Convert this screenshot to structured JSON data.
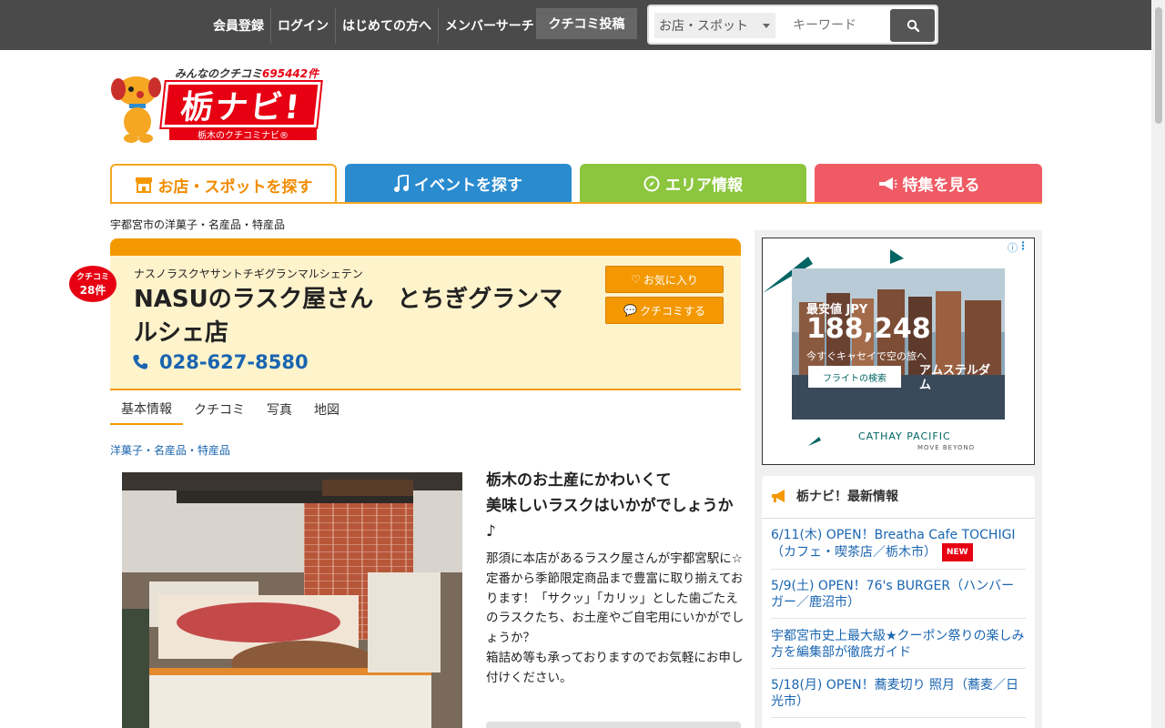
{
  "topnav": {
    "items": [
      "会員登録",
      "ログイン",
      "はじめての方へ",
      "メンバーサーチ"
    ],
    "review_post": "クチコミ投稿",
    "search_select": "お店・スポット",
    "search_placeholder": "キーワード"
  },
  "logo": {
    "count_prefix": "みんなのクチコミ",
    "count": "695442件",
    "title": "栃ナビ!",
    "subtitle": "栃木のクチコミナビ®"
  },
  "tabs": [
    {
      "label": "お店・スポットを探す",
      "icon": "shop-icon",
      "color": "#f39800"
    },
    {
      "label": "イベントを探す",
      "icon": "music-note-icon",
      "color": "#2b8bcf"
    },
    {
      "label": "エリア情報",
      "icon": "compass-icon",
      "color": "#8cc63f"
    },
    {
      "label": "特集を見る",
      "icon": "megaphone-icon",
      "color": "#ef5a64"
    }
  ],
  "breadcrumb": "宇都宮市の洋菓子・名産品・特産品",
  "shop": {
    "badge_top": "クチコミ",
    "badge_count": "28件",
    "kana": "ナスノラスクヤサントチギグランマルシェテン",
    "name": "NASUのラスク屋さん　とちぎグランマルシェ店",
    "phone": "028-627-8580",
    "fav_label": "お気に入り",
    "review_label": "クチコミする"
  },
  "subtabs": [
    "基本情報",
    "クチコミ",
    "写真",
    "地図"
  ],
  "category": "洋菓子・名産品・特産品",
  "description": {
    "title_line1": "栃木のお土産にかわいくて",
    "title_line2": "美味しいラスクはいかがでしょうか♪",
    "body_line1": "那須に本店があるラスク屋さんが宇都宮駅に☆",
    "body_line2": "定番から季節限定商品まで豊富に取り揃えております！「サクッ」「カリッ」とした歯ごたえのラスクたち、お土産やご自宅用にいかがでしょうか？",
    "body_line3": "箱詰め等も承っておりますのでお気軽にお申し付けください。"
  },
  "ad": {
    "label": "最安値 JPY",
    "price": "188,248",
    "tagline": "今すぐキャセイで空の旅へ",
    "button": "フライトの検索",
    "destination": "アムステルダム",
    "brand": "CATHAY PACIFIC",
    "brand_sub": "MOVE BEYOND"
  },
  "news": {
    "heading": "栃ナビ！最新情報",
    "items": [
      {
        "text": "6/11(木) OPEN！Breatha Cafe TOCHIGI（カフェ・喫茶店／栃木市）",
        "badge": "NEW"
      },
      {
        "text": "5/9(土) OPEN！76's BURGER（ハンバーガー／鹿沼市）"
      },
      {
        "text": "宇都宮市史上最大級★クーポン祭りの楽しみ方を編集部が徹底ガイド"
      },
      {
        "text": "5/18(月) OPEN！蕎麦切り 照月（蕎麦／日光市）"
      }
    ]
  }
}
